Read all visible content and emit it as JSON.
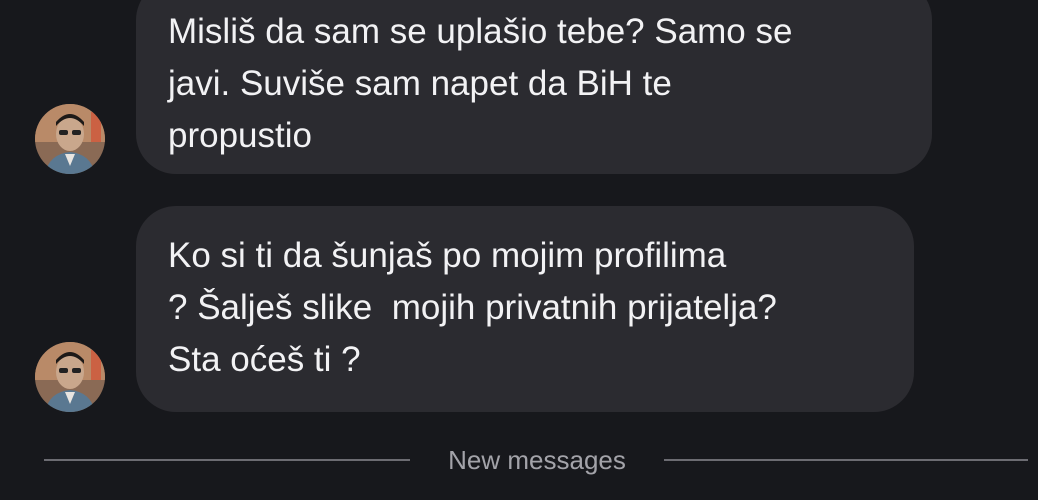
{
  "conversation": {
    "messages": [
      {
        "avatar_icon": "profile-photo-avatar",
        "lines": [
          "Misliš da sam se uplašio tebe? Samo se",
          "javi. Suviše sam napet da BiH te",
          "propustio"
        ]
      },
      {
        "avatar_icon": "profile-photo-avatar",
        "lines": [
          "Ko si ti da šunjaš po mojim profilima",
          "? Šalješ slike  mojih privatnih prijatelja?",
          "Sta oćeš ti ?"
        ]
      }
    ],
    "divider": {
      "label": "New messages"
    }
  },
  "colors": {
    "background": "#17181c",
    "bubble": "#2b2b30",
    "text": "#f2f2f4",
    "divider_text": "#a3a3a9"
  }
}
